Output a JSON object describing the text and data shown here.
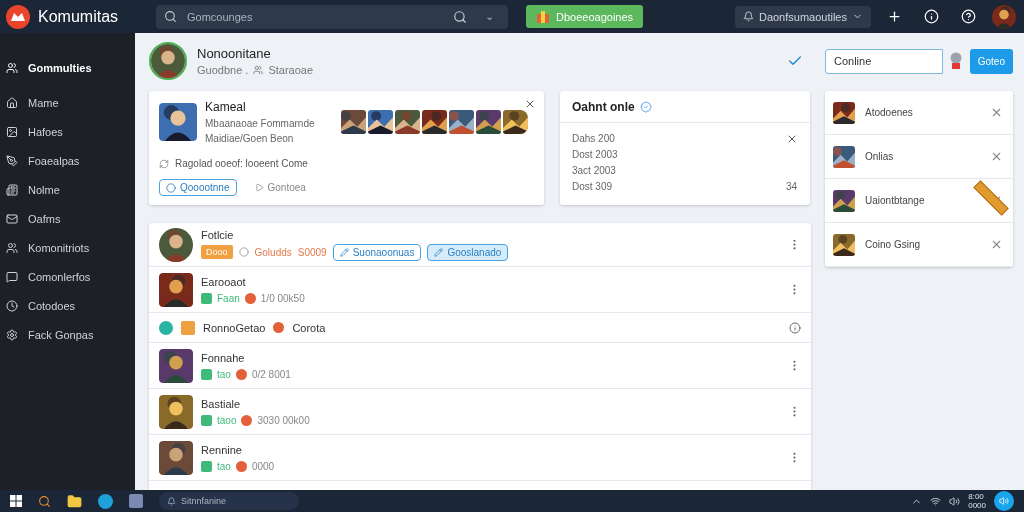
{
  "app": {
    "title": "Komumitas"
  },
  "search": {
    "placeholder": "Gomcounges",
    "caret": "⌄"
  },
  "top_bar": {
    "promo_button": "Dboeeoagoines",
    "account_menu": "Daonfsumaoutiles"
  },
  "sidebar": {
    "items": [
      {
        "label": "Gommulties",
        "selected": true
      },
      {
        "label": "Mame",
        "selected": false
      },
      {
        "label": "Hafoes",
        "selected": false
      },
      {
        "label": "Foaealpas",
        "selected": false
      },
      {
        "label": "Nolme",
        "selected": false
      },
      {
        "label": "Oafms",
        "selected": false
      },
      {
        "label": "Komonitriots",
        "selected": false
      },
      {
        "label": "Comonlerfos",
        "selected": false
      },
      {
        "label": "Cotodoes",
        "selected": false
      },
      {
        "label": "Fack Gonpas",
        "selected": false
      }
    ]
  },
  "profile": {
    "name": "Nonoonitane",
    "subtitle": "Guodbne .",
    "meta": "Staraoae",
    "status_field": "Conline",
    "button": "Goteo"
  },
  "feature_card": {
    "title": "Kameal",
    "lines": [
      "Mbaanaoae Fommarnde",
      "Maidiae/Goen Beon"
    ],
    "footer": "Ragolad ooeof: looeent Come",
    "primary": "Qooootnne",
    "secondary": "Gontoea"
  },
  "online_card": {
    "title": "Oahnt onle",
    "rows": [
      "Dahs 200",
      "Dost 2003",
      "3act 2003",
      "Dost 309"
    ],
    "count": "34"
  },
  "side_list": [
    {
      "label": "Atodoenes",
      "ribbon": false
    },
    {
      "label": "Onlias",
      "ribbon": false
    },
    {
      "label": "Uaiontbtange",
      "ribbon": true
    },
    {
      "label": "Coino Gsing",
      "ribbon": false
    }
  ],
  "feed": [
    {
      "kind": "featured",
      "title": "Fotlcie",
      "badge": "Dooo",
      "note": "Goludds",
      "value": "S0009",
      "actions": [
        {
          "label": "Suonaoonuas",
          "filled": false
        },
        {
          "label": "Gooslanado",
          "filled": true
        }
      ]
    },
    {
      "kind": "post",
      "title": "Earooaot",
      "tag": "Faan",
      "value": "1/0 00k50"
    },
    {
      "kind": "compact",
      "title": "RonnoGetao",
      "tag": "Corota"
    },
    {
      "kind": "post",
      "title": "Fonnahe",
      "tag": "tao",
      "value": "0/2 8001"
    },
    {
      "kind": "post",
      "title": "Bastiale",
      "tag": "taoo",
      "value": "3030 00k00"
    },
    {
      "kind": "post",
      "title": "Rennine",
      "tag": "tao",
      "value": "0000"
    }
  ],
  "taskbar": {
    "search": "Sitnnfanine",
    "clock_time": "8:00",
    "clock_date": "0000"
  }
}
